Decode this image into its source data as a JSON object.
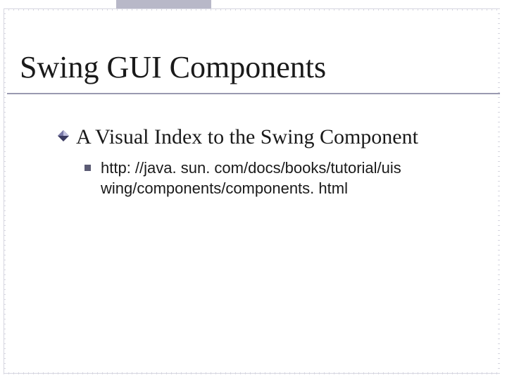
{
  "title": "Swing GUI Components",
  "bullets": {
    "level1": {
      "text": "A Visual Index to the Swing Component"
    },
    "level2": {
      "text": "http: //java. sun. com/docs/books/tutorial/uis wing/components/components. html"
    }
  },
  "accent_bar_color": "#b8b8c8",
  "diamond_colors": {
    "dark": "#3a3a60",
    "mid": "#7a7aa8",
    "light": "#c2c2e0"
  }
}
